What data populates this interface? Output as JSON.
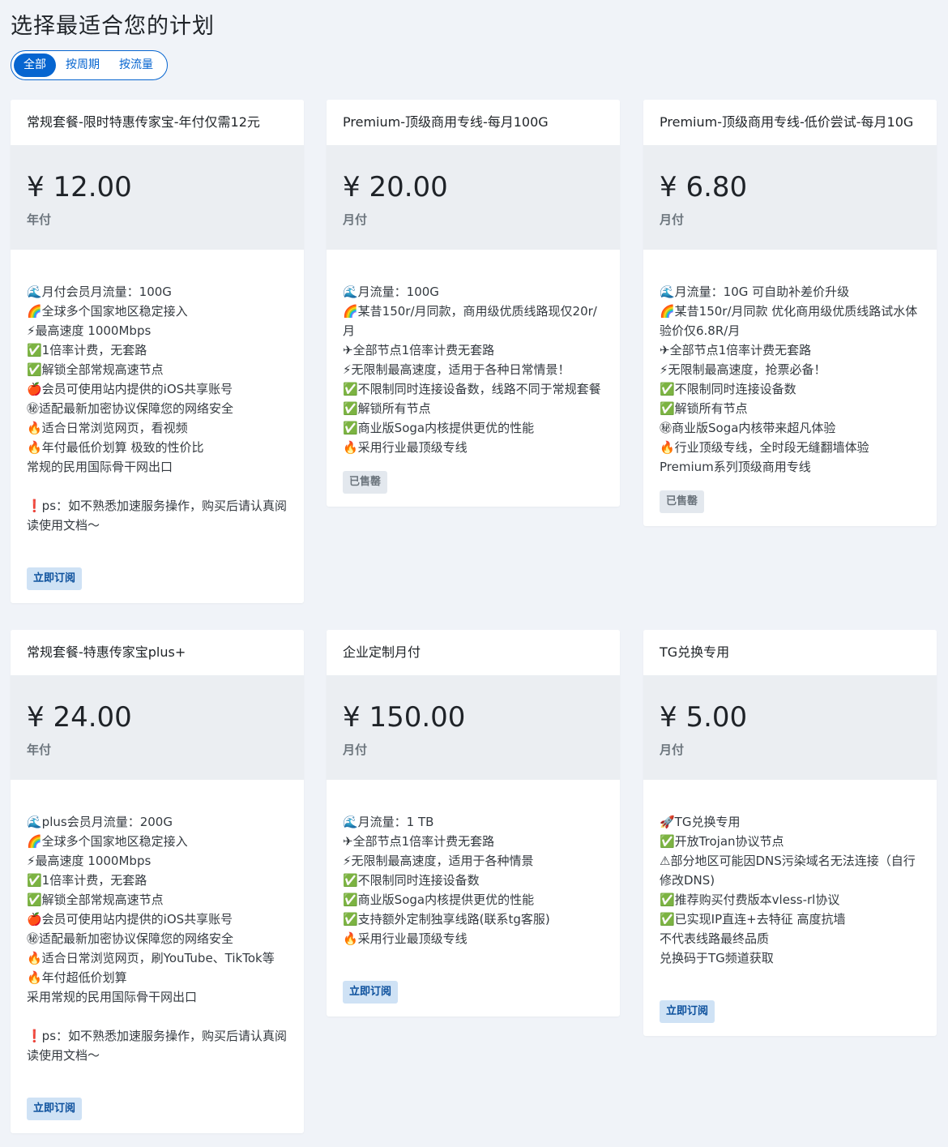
{
  "page": {
    "title": "选择最适合您的计划"
  },
  "tabs": [
    {
      "label": "全部",
      "active": true
    },
    {
      "label": "按周期",
      "active": false
    },
    {
      "label": "按流量",
      "active": false
    }
  ],
  "colors": {
    "accent": "#0665d0",
    "background": "#f0f3f8",
    "price_bg": "#ebeef2"
  },
  "plans": [
    {
      "title": "常规套餐-限时特惠传家宝-年付仅需12元",
      "price": "¥ 12.00",
      "period": "年付",
      "features": [
        "🌊月付会员月流量：100G",
        "🌈全球多个国家地区稳定接入",
        "⚡最高速度 1000Mbps",
        "✅1倍率计费，无套路",
        "✅解锁全部常规高速节点",
        "🍎会员可使用站内提供的iOS共享账号",
        "㊙适配最新加密协议保障您的网络安全",
        "🔥适合日常浏览网页，看视频",
        "🔥年付最低价划算 极致的性价比",
        "常规的民用国际骨干网出口",
        "",
        "❗ps：如不熟悉加速服务操作，购买后请认真阅读使用文档～"
      ],
      "button": "立即订阅",
      "soldout": false
    },
    {
      "title": "Premium-顶级商用专线-每月100G",
      "price": "¥ 20.00",
      "period": "月付",
      "features": [
        "🌊月流量：100G",
        "🌈某昔150r/月同款，商用级优质线路现仅20r/月",
        "✈全部节点1倍率计费无套路",
        "⚡无限制最高速度，适用于各种日常情景！",
        "✅不限制同时连接设备数，线路不同于常规套餐",
        "✅解锁所有节点",
        "✅商业版Soga内核提供更优的性能",
        "🔥采用行业最顶级专线"
      ],
      "button": "已售罄",
      "soldout": true
    },
    {
      "title": "Premium-顶级商用专线-低价尝试-每月10G",
      "price": "¥ 6.80",
      "period": "月付",
      "features": [
        "🌊月流量：10G 可自助补差价升级",
        "🌈某昔150r/月同款 优化商用级优质线路试水体验价仅6.8R/月",
        "✈全部节点1倍率计费无套路",
        "⚡无限制最高速度，抢票必备！",
        "✅不限制同时连接设备数",
        "✅解锁所有节点",
        "㊙商业版Soga内核带来超凡体验",
        "🔥行业顶级专线，全时段无缝翻墙体验",
        "Premium系列顶级商用专线"
      ],
      "button": "已售罄",
      "soldout": true
    },
    {
      "title": "常规套餐-特惠传家宝plus+",
      "price": "¥ 24.00",
      "period": "年付",
      "features": [
        "🌊plus会员月流量：200G",
        "🌈全球多个国家地区稳定接入",
        "⚡最高速度 1000Mbps",
        "✅1倍率计费，无套路",
        "✅解锁全部常规高速节点",
        "🍎会员可使用站内提供的iOS共享账号",
        "㊙适配最新加密协议保障您的网络安全",
        "🔥适合日常浏览网页，刷YouTube、TikTok等",
        "🔥年付超低价划算",
        "采用常规的民用国际骨干网出口",
        "",
        "❗ps：如不熟悉加速服务操作，购买后请认真阅读使用文档～"
      ],
      "button": "立即订阅",
      "soldout": false
    },
    {
      "title": "企业定制月付",
      "price": "¥ 150.00",
      "period": "月付",
      "features": [
        "🌊月流量：1 TB",
        "✈全部节点1倍率计费无套路",
        "⚡无限制最高速度，适用于各种情景",
        "✅不限制同时连接设备数",
        "✅商业版Soga内核提供更优的性能",
        "✅支持额外定制独享线路(联系tg客服)",
        "🔥采用行业最顶级专线"
      ],
      "button": "立即订阅",
      "soldout": false
    },
    {
      "title": "TG兑换专用",
      "price": "¥ 5.00",
      "period": "月付",
      "features": [
        "🚀TG兑换专用",
        "✅开放Trojan协议节点",
        "⚠部分地区可能因DNS污染域名无法连接（自行修改DNS)",
        "✅推荐购买付费版本vless-rl协议",
        "✅已实现IP直连+去特征 高度抗墙",
        "不代表线路最终品质",
        "兑换码于TG频道获取"
      ],
      "button": "立即订阅",
      "soldout": false
    }
  ]
}
